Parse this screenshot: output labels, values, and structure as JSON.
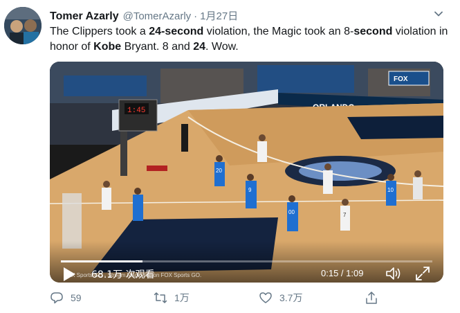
{
  "author": {
    "display_name": "Tomer Azarly",
    "handle": "@TomerAzarly",
    "separator": "·",
    "date": "1月27日"
  },
  "tweet": {
    "segments": [
      {
        "text": "The Clippers took a ",
        "bold": false
      },
      {
        "text": "24-second",
        "bold": true
      },
      {
        "text": " violation, the Magic took an 8-",
        "bold": false
      },
      {
        "text": "second",
        "bold": true
      },
      {
        "text": " violation in honor of ",
        "bold": false
      },
      {
        "text": "Kobe",
        "bold": true
      },
      {
        "text": " Bryant. 8 and ",
        "bold": false
      },
      {
        "text": "24",
        "bold": true
      },
      {
        "text": ". Wow.",
        "bold": false
      }
    ]
  },
  "video": {
    "views": "68.1万 次观看",
    "time": "0:15 / 1:09",
    "progress": 0.22,
    "watermark": "FOX Sports GO · Stream Magic live on FOX Sports GO.",
    "scoreboard": "1:45",
    "network_logo": "FOX",
    "arena_text": "ORLANDO",
    "jerseys": [
      "20",
      "9",
      "00",
      "10",
      "7"
    ]
  },
  "actions": {
    "reply_count": "59",
    "retweet_count": "1万",
    "like_count": "3.7万"
  },
  "icons": [
    "caret-down-icon",
    "play-icon",
    "volume-icon",
    "fullscreen-icon",
    "reply-icon",
    "retweet-icon",
    "like-icon",
    "share-icon"
  ],
  "colors": {
    "text": "#14171a",
    "secondary": "#657786",
    "magic_blue": "#1f6fd1"
  }
}
